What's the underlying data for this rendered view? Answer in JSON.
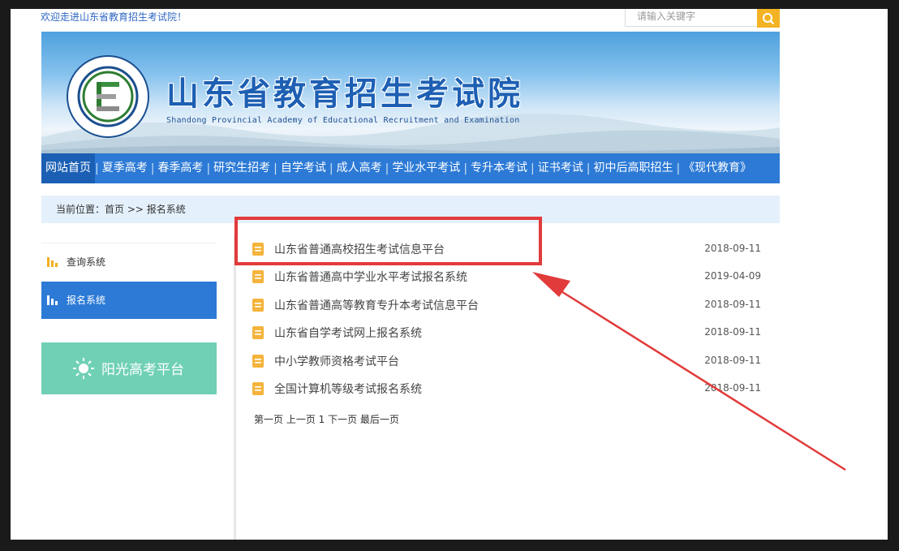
{
  "topbar": {
    "welcome": "欢迎走进山东省教育招生考试院！",
    "search_placeholder": "请输入关键字"
  },
  "banner": {
    "title_cn": "山东省教育招生考试院",
    "title_en": "Shandong Provincial Academy of Educational Recruitment and Examination"
  },
  "nav": {
    "items": [
      {
        "label": "网站首页"
      },
      {
        "label": "夏季高考"
      },
      {
        "label": "春季高考"
      },
      {
        "label": "研究生招考"
      },
      {
        "label": "自学考试"
      },
      {
        "label": "成人高考"
      },
      {
        "label": "学业水平考试"
      },
      {
        "label": "专升本考试"
      },
      {
        "label": "证书考试"
      },
      {
        "label": "初中后高职招生"
      },
      {
        "label": "《现代教育》"
      }
    ]
  },
  "breadcrumb": "当前位置：首页 >> 报名系统",
  "sidebar": {
    "items": [
      {
        "label": "查询系统"
      },
      {
        "label": "报名系统"
      }
    ],
    "sunshine_label": "阳光高考平台"
  },
  "list": {
    "rows": [
      {
        "title": "山东省普通高校招生考试信息平台",
        "date": "2018-09-11"
      },
      {
        "title": "山东省普通高中学业水平考试报名系统",
        "date": "2019-04-09"
      },
      {
        "title": "山东省普通高等教育专升本考试信息平台",
        "date": "2018-09-11"
      },
      {
        "title": "山东省自学考试网上报名系统",
        "date": "2018-09-11"
      },
      {
        "title": "中小学教师资格考试平台",
        "date": "2018-09-11"
      },
      {
        "title": "全国计算机等级考试报名系统",
        "date": "2018-09-11"
      }
    ]
  },
  "pager": "第一页 上一页 1 下一页 最后一页",
  "colors": {
    "nav_blue": "#2c7ad6",
    "highlight_red": "#e23b3b",
    "doc_icon_orange": "#f4b43c",
    "sunshine_green": "#6fd0b5"
  },
  "icons": {
    "search": "search-icon",
    "doc": "document-icon",
    "bar_chart": "bar-chart-icon",
    "sun": "sun-icon"
  }
}
